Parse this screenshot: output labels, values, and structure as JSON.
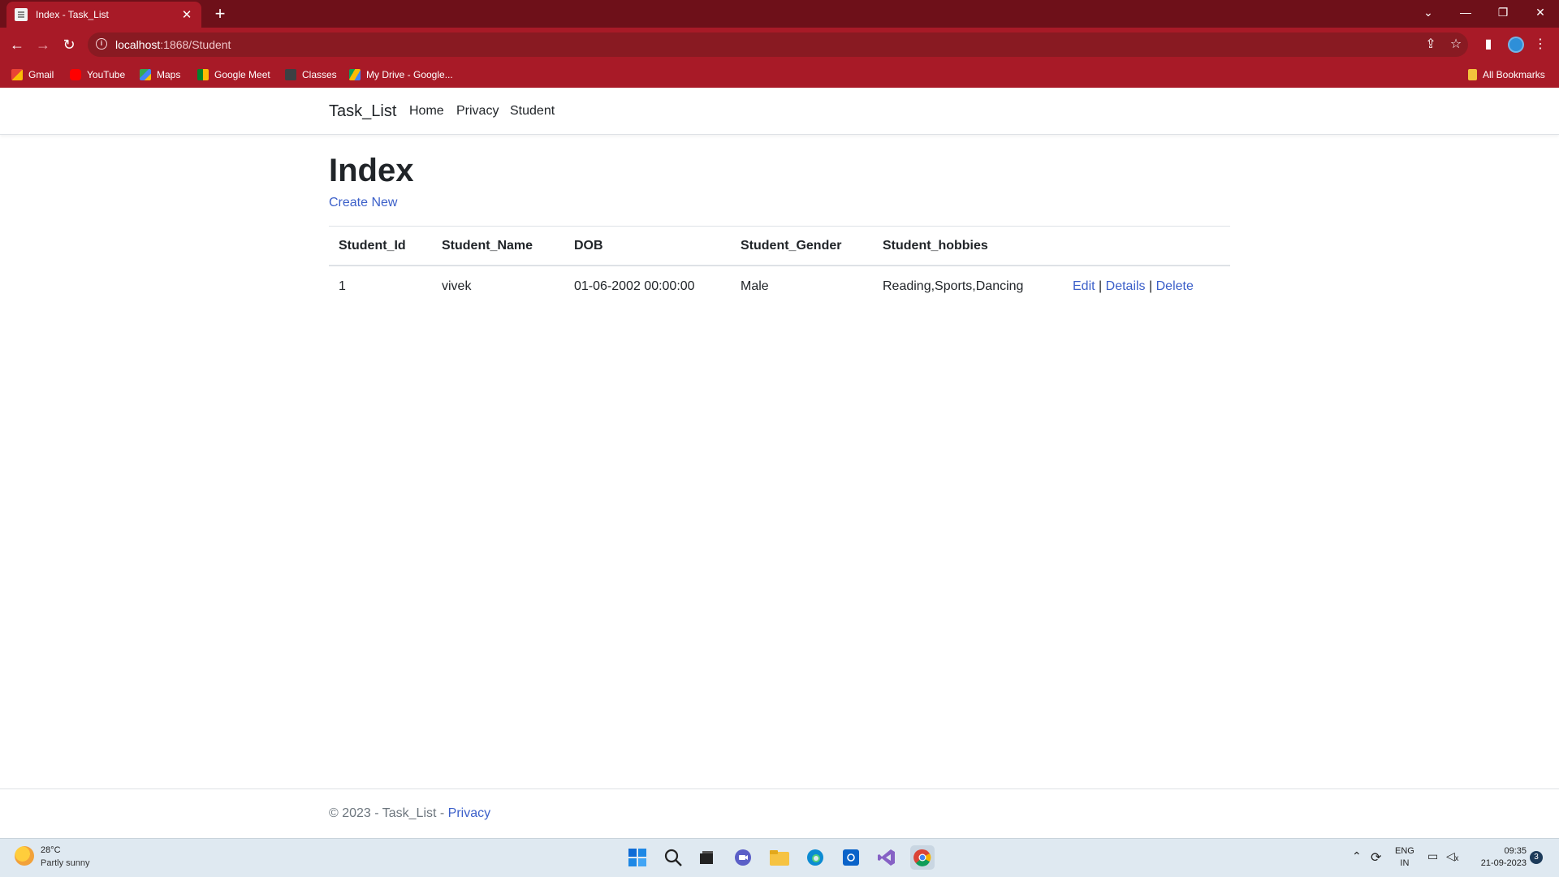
{
  "browser": {
    "tab_title": "Index - Task_List",
    "tab_close": "✕",
    "new_tab": "+",
    "url_host": "localhost",
    "url_rest": ":1868/Student",
    "bookmarks": [
      "Gmail",
      "YouTube",
      "Maps",
      "Google Meet",
      "Classes",
      "My Drive - Google..."
    ],
    "all_bookmarks": "All Bookmarks"
  },
  "site": {
    "brand": "Task_List",
    "nav": [
      "Home",
      "Privacy",
      "Student"
    ]
  },
  "main": {
    "title": "Index",
    "create_link": "Create New",
    "table": {
      "headers": [
        "Student_Id",
        "Student_Name",
        "DOB",
        "Student_Gender",
        "Student_hobbies"
      ],
      "rows": [
        {
          "id": "1",
          "name": "vivek",
          "dob": "01-06-2002 00:00:00",
          "gender": "Male",
          "hobbies": "Reading,Sports,Dancing",
          "actions": [
            "Edit",
            "Details",
            "Delete"
          ]
        }
      ],
      "separator": "|"
    }
  },
  "footer": {
    "text": "© 2023 - Task_List - ",
    "link": "Privacy"
  },
  "taskbar": {
    "temperature": "28°C",
    "weather": "Partly sunny",
    "lang_top": "ENG",
    "lang_bottom": "IN",
    "time": "09:35",
    "date": "21-09-2023",
    "notification_count": "3"
  },
  "colors": {
    "chrome_dark": "#6e1019",
    "chrome": "#a81a27",
    "link": "#3b5fc9"
  }
}
